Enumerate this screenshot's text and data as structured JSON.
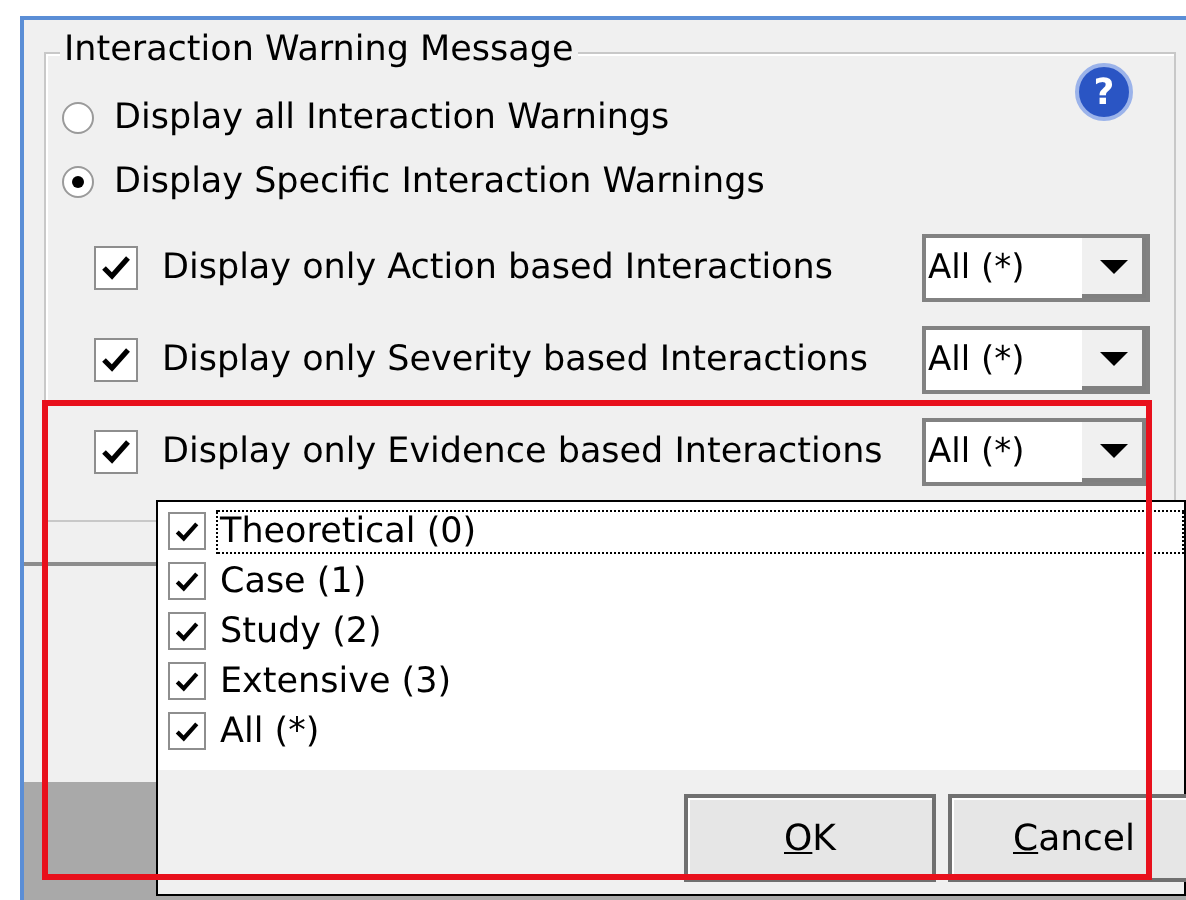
{
  "group": {
    "title": "Interaction Warning Message"
  },
  "help": {
    "glyph": "?"
  },
  "modes": [
    {
      "label": "Display all Interaction Warnings",
      "selected": false
    },
    {
      "label": "Display Specific Interaction Warnings",
      "selected": true
    }
  ],
  "filters": [
    {
      "label": "Display only Action based Interactions",
      "checked": true,
      "value": "All (*)",
      "highlighted": false
    },
    {
      "label": "Display only Severity based Interactions",
      "checked": true,
      "value": "All (*)",
      "highlighted": false
    },
    {
      "label": "Display only Evidence based Interactions",
      "checked": true,
      "value": "All (*)",
      "highlighted": true
    }
  ],
  "popup": {
    "items": [
      {
        "label": "Theoretical (0)",
        "checked": true,
        "focused": true
      },
      {
        "label": "Case (1)",
        "checked": true,
        "focused": false
      },
      {
        "label": "Study (2)",
        "checked": true,
        "focused": false
      },
      {
        "label": "Extensive (3)",
        "checked": true,
        "focused": false
      },
      {
        "label": "All (*)",
        "checked": true,
        "focused": false
      }
    ],
    "buttons": [
      "OK",
      "Cancel"
    ]
  }
}
